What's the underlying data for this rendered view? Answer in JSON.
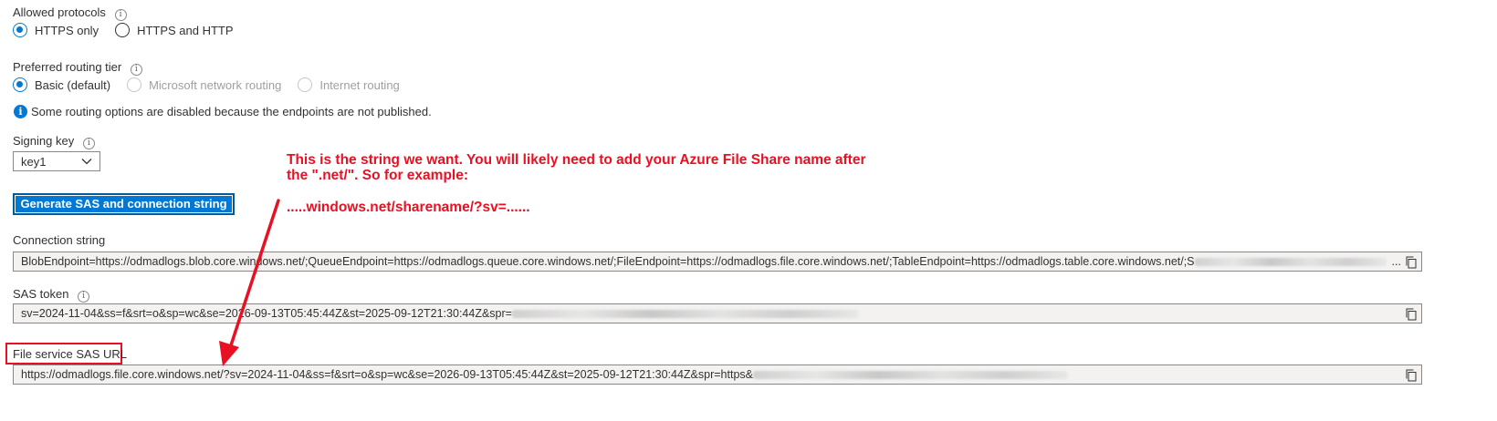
{
  "allowed_protocols": {
    "label": "Allowed protocols",
    "options": [
      {
        "label": "HTTPS only",
        "checked": true,
        "disabled": false
      },
      {
        "label": "HTTPS and HTTP",
        "checked": false,
        "disabled": false
      }
    ]
  },
  "routing": {
    "label": "Preferred routing tier",
    "options": [
      {
        "label": "Basic (default)",
        "checked": true,
        "disabled": false
      },
      {
        "label": "Microsoft network routing",
        "checked": false,
        "disabled": true
      },
      {
        "label": "Internet routing",
        "checked": false,
        "disabled": true
      }
    ],
    "info_message": "Some routing options are disabled because the endpoints are not published."
  },
  "signing_key": {
    "label": "Signing key",
    "selected": "key1"
  },
  "generate_button": {
    "label": "Generate SAS and connection string"
  },
  "connection_string": {
    "label": "Connection string",
    "value": "BlobEndpoint=https://odmadlogs.blob.core.windows.net/;QueueEndpoint=https://odmadlogs.queue.core.windows.net/;FileEndpoint=https://odmadlogs.file.core.windows.net/;TableEndpoint=https://odmadlogs.table.core.windows.net/;S",
    "trailing": "..."
  },
  "sas_token": {
    "label": "SAS token",
    "value": "sv=2024-11-04&ss=f&srt=o&sp=wc&se=2026-09-13T05:45:44Z&st=2025-09-12T21:30:44Z&spr="
  },
  "file_sas_url": {
    "label": "File service SAS URL",
    "value": "https://odmadlogs.file.core.windows.net/?sv=2024-11-04&ss=f&srt=o&sp=wc&se=2026-09-13T05:45:44Z&st=2025-09-12T21:30:44Z&spr=https&"
  },
  "annotation": {
    "line1": "This is the string we want. You will likely need to add your Azure File Share name after",
    "line2": "the \".net/\". So for example:",
    "line3": ".....windows.net/sharename/?sv=......"
  },
  "colors": {
    "accent": "#0078d4",
    "annotation_red": "#e81123",
    "field_bg": "#f3f2f1"
  },
  "icons": [
    "info-icon",
    "info-solid-icon",
    "chevron-down-icon",
    "copy-icon"
  ]
}
